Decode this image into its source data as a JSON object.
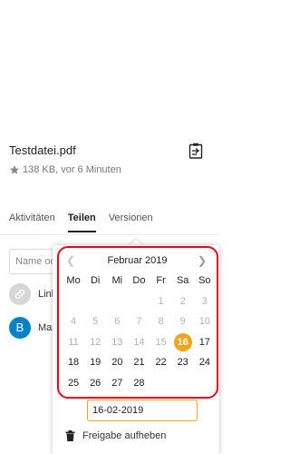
{
  "file": {
    "name": "Testdatei.pdf",
    "meta": "138 KB, vor 6 Minuten"
  },
  "tabs": [
    {
      "label": "Aktivitäten",
      "active": false
    },
    {
      "label": "Teilen",
      "active": true
    },
    {
      "label": "Versionen",
      "active": false
    }
  ],
  "share": {
    "input_placeholder": "Name oder",
    "link_label": "Link",
    "user_initial": "B",
    "user_label": "Max"
  },
  "calendar": {
    "month_title": "Februar 2019",
    "weekdays": [
      "Mo",
      "Di",
      "Mi",
      "Do",
      "Fr",
      "Sa",
      "So"
    ],
    "weeks": [
      [
        "",
        "",
        "",
        "",
        "1",
        "2",
        "3"
      ],
      [
        "4",
        "5",
        "6",
        "7",
        "8",
        "9",
        "10"
      ],
      [
        "11",
        "12",
        "13",
        "14",
        "15",
        "16",
        "17"
      ],
      [
        "18",
        "19",
        "20",
        "21",
        "22",
        "23",
        "24"
      ],
      [
        "25",
        "26",
        "27",
        "28",
        "",
        "",
        ""
      ]
    ],
    "selected_day": "16",
    "first_enabled_day": "16"
  },
  "expiry": {
    "date_value": "16-02-2019"
  },
  "actions": {
    "unshare_label": "Freigabe aufheben"
  },
  "colors": {
    "accent": "#f7a21b",
    "highlight_border": "#e8001c",
    "avatar_user": "#0082c9"
  }
}
